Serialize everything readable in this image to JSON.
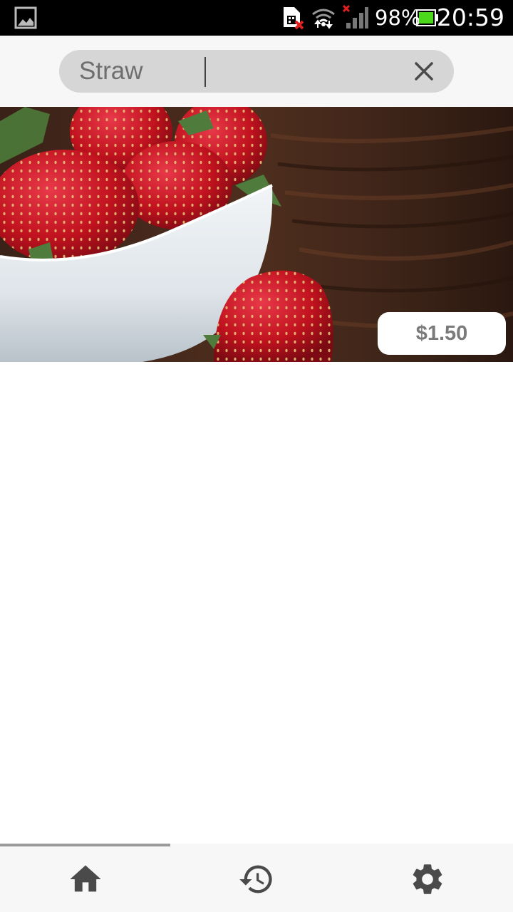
{
  "status_bar": {
    "battery_text": "98%",
    "time": "20:59",
    "icons": [
      "gallery-icon",
      "sim-error-icon",
      "wifi-icon",
      "signal-icon",
      "battery-icon"
    ]
  },
  "search": {
    "value": "Straw",
    "clear_icon": "close-icon"
  },
  "product": {
    "image_icon": "strawberries-photo",
    "price": "$1.50"
  },
  "bottom_nav": {
    "active_tab": "home",
    "items": [
      {
        "icon": "home-icon"
      },
      {
        "icon": "history-icon"
      },
      {
        "icon": "settings-icon"
      }
    ]
  },
  "colors": {
    "status_bar": "#000000",
    "search_bg": "#d6d6d6",
    "header_bg": "#f7f7f7",
    "nav_bg": "#f7f7f7",
    "icon_dark": "#4a4a4a",
    "price_text": "#7a7a7a"
  }
}
